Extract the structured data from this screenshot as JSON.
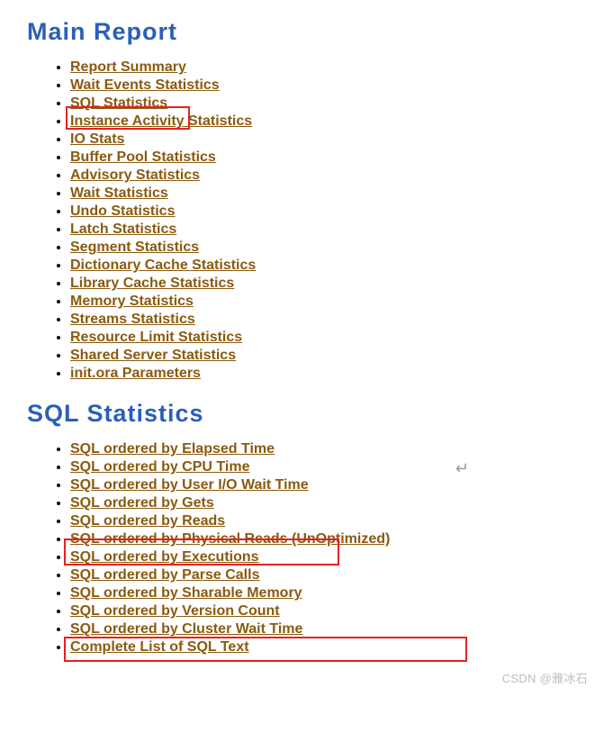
{
  "main_heading": "Main Report",
  "main_items": [
    "Report Summary",
    "Wait Events Statistics",
    "SQL Statistics",
    "Instance Activity Statistics",
    "IO Stats",
    "Buffer Pool Statistics",
    "Advisory Statistics",
    "Wait Statistics",
    "Undo Statistics",
    "Latch Statistics",
    "Segment Statistics",
    "Dictionary Cache Statistics",
    "Library Cache Statistics",
    "Memory Statistics",
    "Streams Statistics",
    "Resource Limit Statistics",
    "Shared Server Statistics",
    "init.ora Parameters"
  ],
  "sql_heading": "SQL Statistics",
  "sql_items": [
    "SQL ordered by Elapsed Time",
    "SQL ordered by CPU Time",
    "SQL ordered by User I/O Wait Time",
    "SQL ordered by Gets",
    "SQL ordered by Reads",
    "SQL ordered by Physical Reads (UnOptimized)",
    "SQL ordered by Executions",
    "SQL ordered by Parse Calls",
    "SQL ordered by Sharable Memory",
    "SQL ordered by Version Count",
    "SQL ordered by Cluster Wait Time",
    "Complete List of SQL Text"
  ],
  "arrow": "↵",
  "watermark": "CSDN @雅冰石"
}
